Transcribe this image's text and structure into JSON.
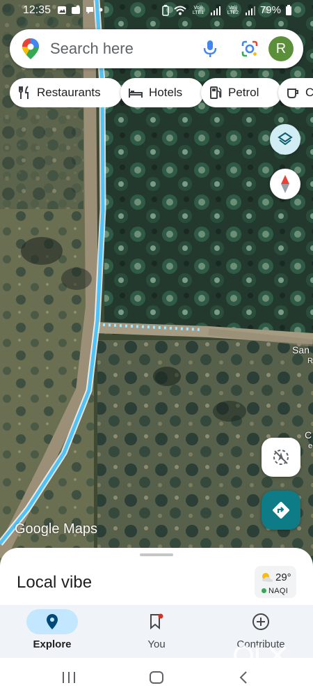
{
  "status_bar": {
    "time": "12:35",
    "sim1_label": "Vo)) LTE1",
    "sim2_label": "Vo)) LTE2",
    "battery": "79%"
  },
  "search": {
    "placeholder": "Search here",
    "avatar_initial": "R"
  },
  "chips": [
    {
      "label": "Restaurants",
      "icon": "fork-knife-icon"
    },
    {
      "label": "Hotels",
      "icon": "bed-icon"
    },
    {
      "label": "Petrol",
      "icon": "fuel-pump-icon"
    },
    {
      "label": "C",
      "icon": "coffee-icon"
    }
  ],
  "map": {
    "watermark": "Google Maps",
    "place_label_1": "San",
    "place_label_1b": "R",
    "place_label_2": "C",
    "place_label_2b": "e",
    "route_color": "#4fc3f7"
  },
  "sheet": {
    "title": "Local vibe",
    "weather_temp": "29°",
    "aqi_label": "NAQI"
  },
  "bottom_nav": [
    {
      "label": "Explore",
      "icon": "location-pin-icon",
      "active": true
    },
    {
      "label": "You",
      "icon": "bookmark-icon",
      "active": false
    },
    {
      "label": "Contribute",
      "icon": "plus-circle-icon",
      "active": false
    }
  ],
  "colors": {
    "accent": "#1a73e8",
    "nav_active_pill": "#c2e7ff",
    "directions_fab": "#0e7c86"
  }
}
